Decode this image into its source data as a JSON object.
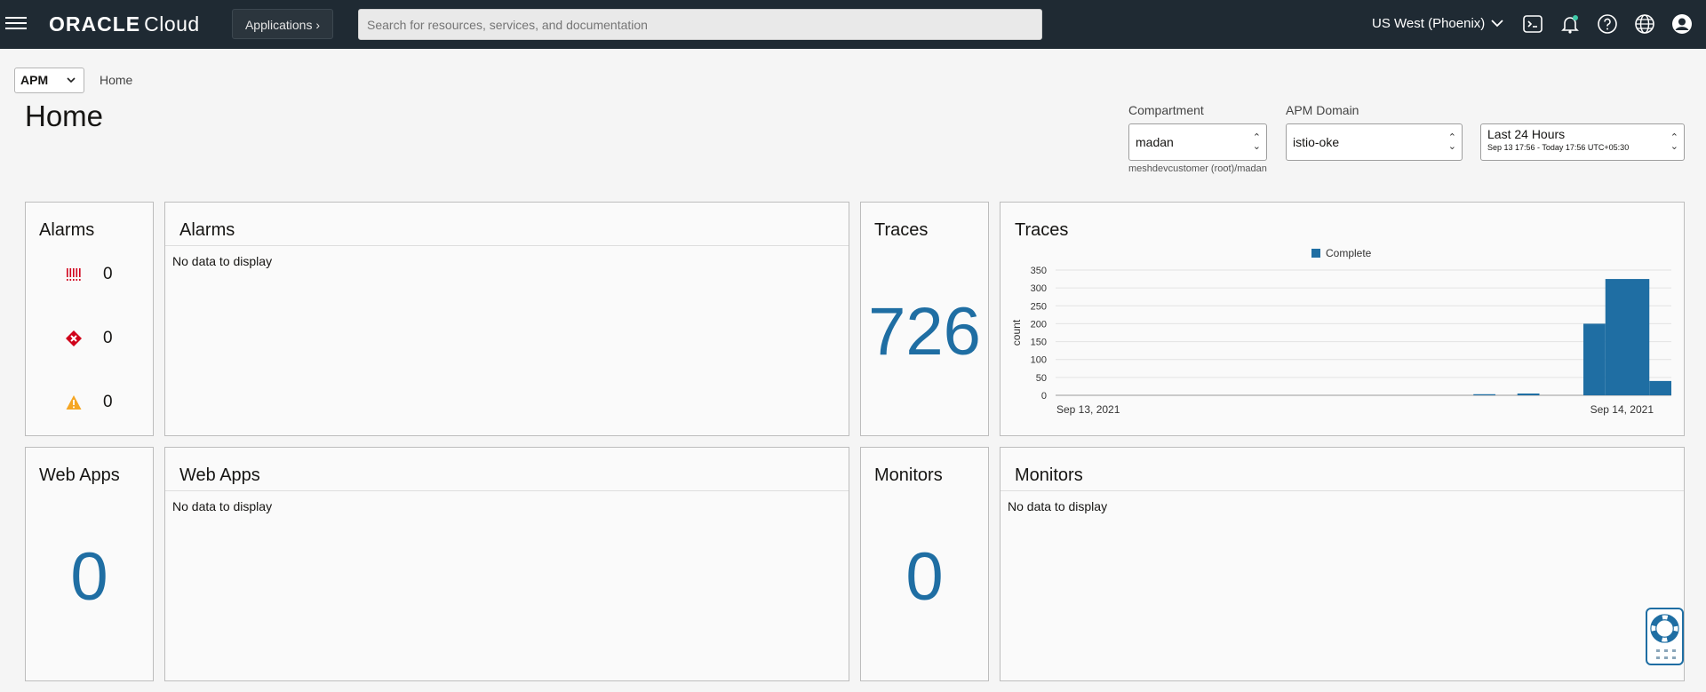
{
  "topbar": {
    "logo_brand": "ORACLE",
    "logo_product": "Cloud",
    "applications_label": "Applications",
    "search_placeholder": "Search for resources, services, and documentation",
    "region": "US West (Phoenix)",
    "icons": [
      "terminal-icon",
      "bell-icon",
      "help-icon",
      "globe-icon",
      "user-icon"
    ]
  },
  "header": {
    "service_select": "APM",
    "breadcrumb": "Home",
    "title": "Home",
    "compartment_label": "Compartment",
    "compartment_value": "madan",
    "compartment_path": "meshdevcustomer (root)/madan",
    "domain_label": "APM Domain",
    "domain_value": "istio-oke",
    "time_range": "Last 24 Hours",
    "time_detail": "Sep 13 17:56 - Today 17:56 UTC+05:30"
  },
  "alarms_summary": {
    "title": "Alarms",
    "critical": "0",
    "major": "0",
    "warning": "0"
  },
  "alarms_panel": {
    "title": "Alarms",
    "empty": "No data to display"
  },
  "traces_summary": {
    "title": "Traces",
    "count": "726"
  },
  "traces_panel": {
    "title": "Traces"
  },
  "webapps_summary": {
    "title": "Web Apps",
    "count": "0"
  },
  "webapps_panel": {
    "title": "Web Apps",
    "empty": "No data to display"
  },
  "monitors_summary": {
    "title": "Monitors",
    "count": "0"
  },
  "monitors_panel": {
    "title": "Monitors",
    "empty": "No data to display"
  },
  "colors": {
    "accent": "#1f6ea3",
    "bar": "#1f6ea3",
    "topbar": "#1f2a33",
    "critical": "#d0021b",
    "warning": "#f5a623"
  },
  "chart_data": {
    "type": "bar",
    "ylabel": "count",
    "ylim": [
      0,
      350
    ],
    "yticks": [
      0,
      50,
      100,
      150,
      200,
      250,
      300,
      350
    ],
    "xtick_labels": [
      "Sep 13, 2021",
      "Sep 14, 2021"
    ],
    "legend": [
      "Complete"
    ],
    "legend_position": "top",
    "series": [
      {
        "name": "Complete",
        "values": [
          0,
          0,
          0,
          0,
          0,
          0,
          0,
          0,
          0,
          0,
          0,
          0,
          0,
          0,
          0,
          0,
          0,
          0,
          0,
          3,
          0,
          5,
          0,
          0,
          200,
          325,
          325,
          40
        ]
      }
    ],
    "grid": true
  }
}
